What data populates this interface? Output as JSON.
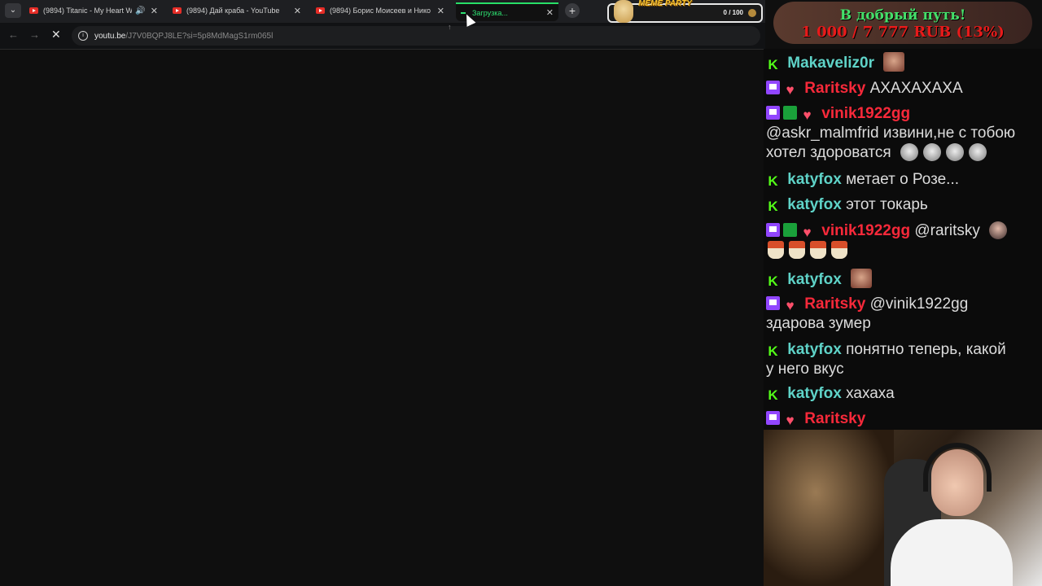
{
  "browser": {
    "tabs": [
      {
        "title": "(9894) Titanic - My Heart W",
        "icon": "youtube-icon",
        "audio": true
      },
      {
        "title": "(9894) Дай краба - YouTube",
        "icon": "youtube-icon",
        "audio": false
      },
      {
        "title": "(9894) Борис Моисеев и Нико",
        "icon": "youtube-icon",
        "audio": false
      },
      {
        "title": "Загрузка...",
        "icon": "loading-spinner-icon",
        "active": true
      }
    ],
    "close_glyph": "✕",
    "audio_glyph": "🔊",
    "new_tab_glyph": "+",
    "dropdown_glyph": "⌄",
    "back_glyph": "←",
    "forward_glyph": "→",
    "stop_glyph": "✕",
    "info_glyph": "i",
    "url_host": "youtu.be",
    "url_path": "/J7V0BQPJ8LE?si=5p8MdMagS1rm065l"
  },
  "meme_widget": {
    "title": "MEME PARTY",
    "count": "0 / 100"
  },
  "donation": {
    "heading": "В добрый путь!",
    "amount": "1 000 / 7 777 RUB (13%)",
    "progress_fraction": 0.13
  },
  "chat": {
    "messages": [
      {
        "user": "Makaveliz0r",
        "text": "",
        "badges": [
          "kick"
        ]
      },
      {
        "user": "Raritsky",
        "text": "АХАХАХАХА",
        "badges": [
          "twitch",
          "heart"
        ]
      },
      {
        "user": "vinik1922gg",
        "text": "@askr_malmfrid извини,не с тобою хотел здороватся",
        "badges": [
          "twitch",
          "sword",
          "heart"
        ]
      },
      {
        "user": "katyfox",
        "text": "метает о Розе...",
        "badges": [
          "kick"
        ]
      },
      {
        "user": "katyfox",
        "text": "этот токарь",
        "badges": [
          "kick"
        ]
      },
      {
        "user": "vinik1922gg",
        "text": "@raritsky",
        "badges": [
          "twitch",
          "sword",
          "heart"
        ]
      },
      {
        "user": "katyfox",
        "text": "",
        "badges": [
          "kick"
        ]
      },
      {
        "user": "Raritsky",
        "text": "@vinik1922gg",
        "text2": "здарова зумер",
        "badges": [
          "twitch",
          "heart"
        ]
      },
      {
        "user": "katyfox",
        "text": "понятно теперь, какой",
        "text2": "у него вкус",
        "badges": [
          "kick"
        ]
      },
      {
        "user": "katyfox",
        "text": "хахаха",
        "badges": [
          "kick"
        ]
      },
      {
        "user": "Raritsky",
        "text": "",
        "badges": [
          "twitch",
          "heart"
        ]
      }
    ],
    "kick_glyph": "K",
    "heart_glyph": "♥"
  },
  "colors": {
    "kick_green": "#53fc18",
    "twitch_purple": "#9146ff",
    "donation_green": "#44e06a",
    "donation_red": "#e81a1a",
    "loading_green": "#2ee071"
  }
}
